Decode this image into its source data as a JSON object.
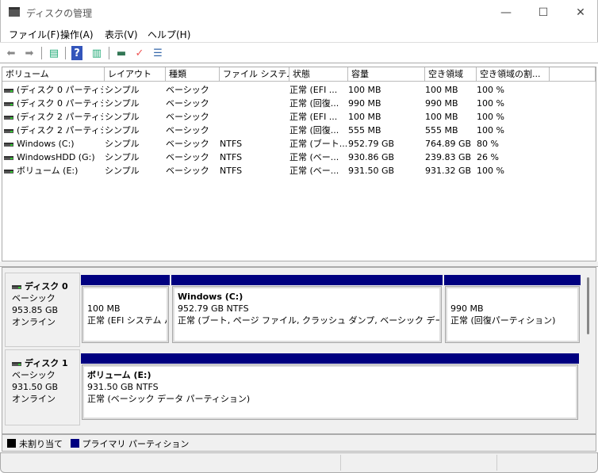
{
  "window": {
    "title": "ディスクの管理",
    "minimize": "—",
    "maximize": "☐",
    "close": "✕"
  },
  "menu": [
    "ファイル(F)",
    "操作(A)",
    "表示(V)",
    "ヘルプ(H)"
  ],
  "columns": [
    "ボリューム",
    "レイアウト",
    "種類",
    "ファイル システム",
    "状態",
    "容量",
    "空き領域",
    "空き領域の割..."
  ],
  "volumes": [
    [
      "(ディスク 0 パーティシ...",
      "シンプル",
      "ベーシック",
      "",
      "正常 (EFI ...",
      "100 MB",
      "100 MB",
      "100 %"
    ],
    [
      "(ディスク 0 パーティシ...",
      "シンプル",
      "ベーシック",
      "",
      "正常 (回復...",
      "990 MB",
      "990 MB",
      "100 %"
    ],
    [
      "(ディスク 2 パーティシ...",
      "シンプル",
      "ベーシック",
      "",
      "正常 (EFI ...",
      "100 MB",
      "100 MB",
      "100 %"
    ],
    [
      "(ディスク 2 パーティシ...",
      "シンプル",
      "ベーシック",
      "",
      "正常 (回復...",
      "555 MB",
      "555 MB",
      "100 %"
    ],
    [
      "Windows (C:)",
      "シンプル",
      "ベーシック",
      "NTFS",
      "正常 (ブート...",
      "952.79 GB",
      "764.89 GB",
      "80 %"
    ],
    [
      "WindowsHDD (G:)",
      "シンプル",
      "ベーシック",
      "NTFS",
      "正常 (ベー...",
      "930.86 GB",
      "239.83 GB",
      "26 %"
    ],
    [
      "ボリューム (E:)",
      "シンプル",
      "ベーシック",
      "NTFS",
      "正常 (ベー...",
      "931.50 GB",
      "931.32 GB",
      "100 %"
    ]
  ],
  "disks": [
    {
      "name": "ディスク 0",
      "type": "ベーシック",
      "size": "953.85 GB",
      "status": "オンライン",
      "partitions": [
        {
          "title": "",
          "size": "100 MB",
          "status": "正常 (EFI システム パ"
        },
        {
          "title": "Windows  (C:)",
          "size": "952.79 GB NTFS",
          "status": "正常 (ブート, ページ ファイル, クラッシュ ダンプ, ベーシック データ パーティシ"
        },
        {
          "title": "",
          "size": "990 MB",
          "status": "正常 (回復パーティション)"
        }
      ]
    },
    {
      "name": "ディスク 1",
      "type": "ベーシック",
      "size": "931.50 GB",
      "status": "オンライン",
      "partitions": [
        {
          "title": "ボリューム  (E:)",
          "size": "931.50 GB NTFS",
          "status": "正常 (ベーシック データ パーティション)"
        }
      ]
    }
  ],
  "legend": [
    {
      "label": "未割り当て",
      "color": "#000000"
    },
    {
      "label": "プライマリ パーティション",
      "color": "#000080"
    }
  ]
}
